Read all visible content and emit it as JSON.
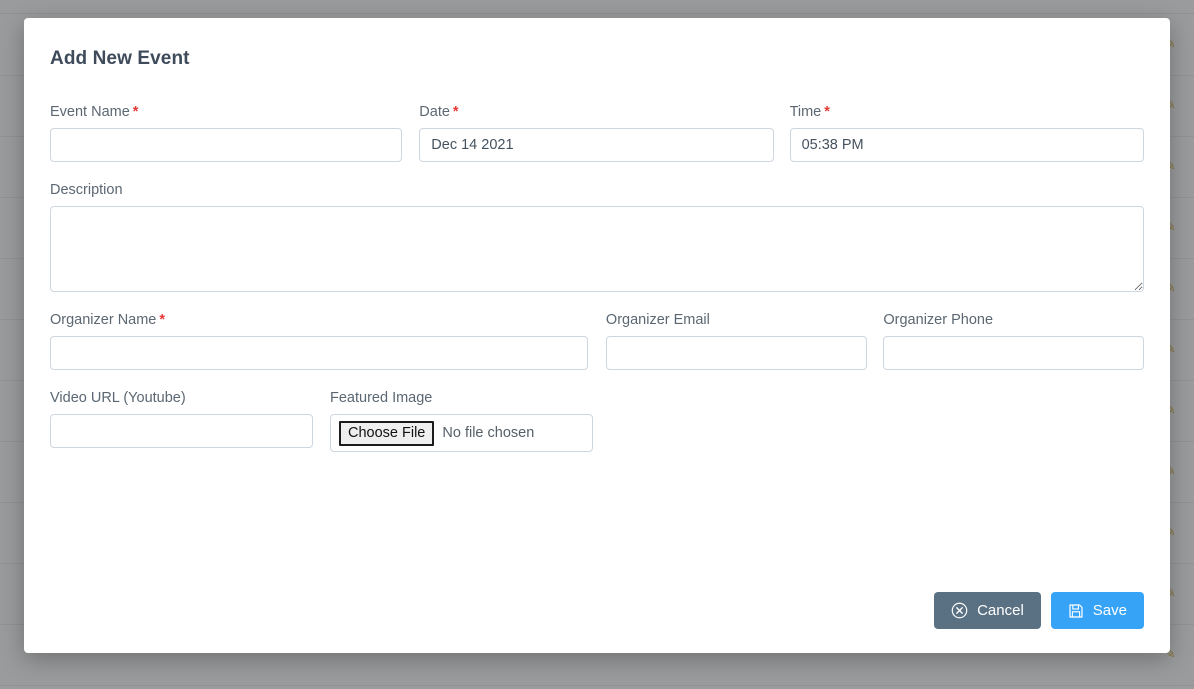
{
  "background": {
    "row_action_icon": "edit-pencil-icon",
    "row_count": 11,
    "overlay_color": "#55585c"
  },
  "modal": {
    "title": "Add New Event",
    "fields": {
      "event_name": {
        "label": "Event Name",
        "required_marker": "*",
        "value": "",
        "placeholder": ""
      },
      "date": {
        "label": "Date",
        "required_marker": "*",
        "value": "Dec 14 2021",
        "placeholder": ""
      },
      "time": {
        "label": "Time",
        "required_marker": "*",
        "value": "05:38 PM",
        "placeholder": ""
      },
      "description": {
        "label": "Description",
        "value": "",
        "placeholder": ""
      },
      "organizer_name": {
        "label": "Organizer Name",
        "required_marker": "*",
        "value": "",
        "placeholder": ""
      },
      "organizer_email": {
        "label": "Organizer Email",
        "value": "",
        "placeholder": ""
      },
      "organizer_phone": {
        "label": "Organizer Phone",
        "value": "",
        "placeholder": ""
      },
      "video_url": {
        "label": "Video URL (Youtube)",
        "value": "",
        "placeholder": ""
      },
      "featured_image": {
        "label": "Featured Image",
        "button_label": "Choose File",
        "status_text": "No file chosen"
      }
    },
    "footer": {
      "cancel_label": "Cancel",
      "cancel_icon": "circle-x-icon",
      "cancel_color": "#5a7184",
      "save_label": "Save",
      "save_icon": "floppy-save-icon",
      "save_color": "#36a3f7"
    }
  },
  "colors": {
    "required_asterisk": "#e53935",
    "label_text": "#5b6772",
    "title_text": "#3f4b5b",
    "input_border": "#ced6df"
  }
}
